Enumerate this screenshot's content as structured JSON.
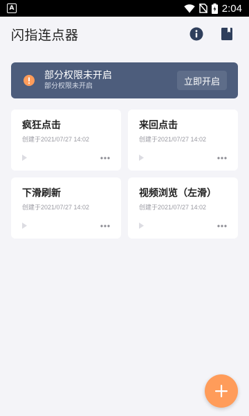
{
  "status_bar": {
    "time": "2:04"
  },
  "app_bar": {
    "title": "闪指连点器"
  },
  "banner": {
    "title": "部分权限未开启",
    "subtitle": "部分权限未开启",
    "button_label": "立即开启"
  },
  "cards": [
    {
      "title": "疯狂点击",
      "date": "创建于2021/07/27 14:02"
    },
    {
      "title": "来回点击",
      "date": "创建于2021/07/27 14:02"
    },
    {
      "title": "下滑刷新",
      "date": "创建于2021/07/27 14:02"
    },
    {
      "title": "视频浏览（左滑）",
      "date": "创建于2021/07/27 14:02"
    }
  ],
  "colors": {
    "banner_bg": "#4d5d7c",
    "banner_button": "#5e6d89",
    "warning_accent": "#ff9c5a",
    "fab": "#ff9c5a",
    "app_icon": "#2f3f5c"
  }
}
